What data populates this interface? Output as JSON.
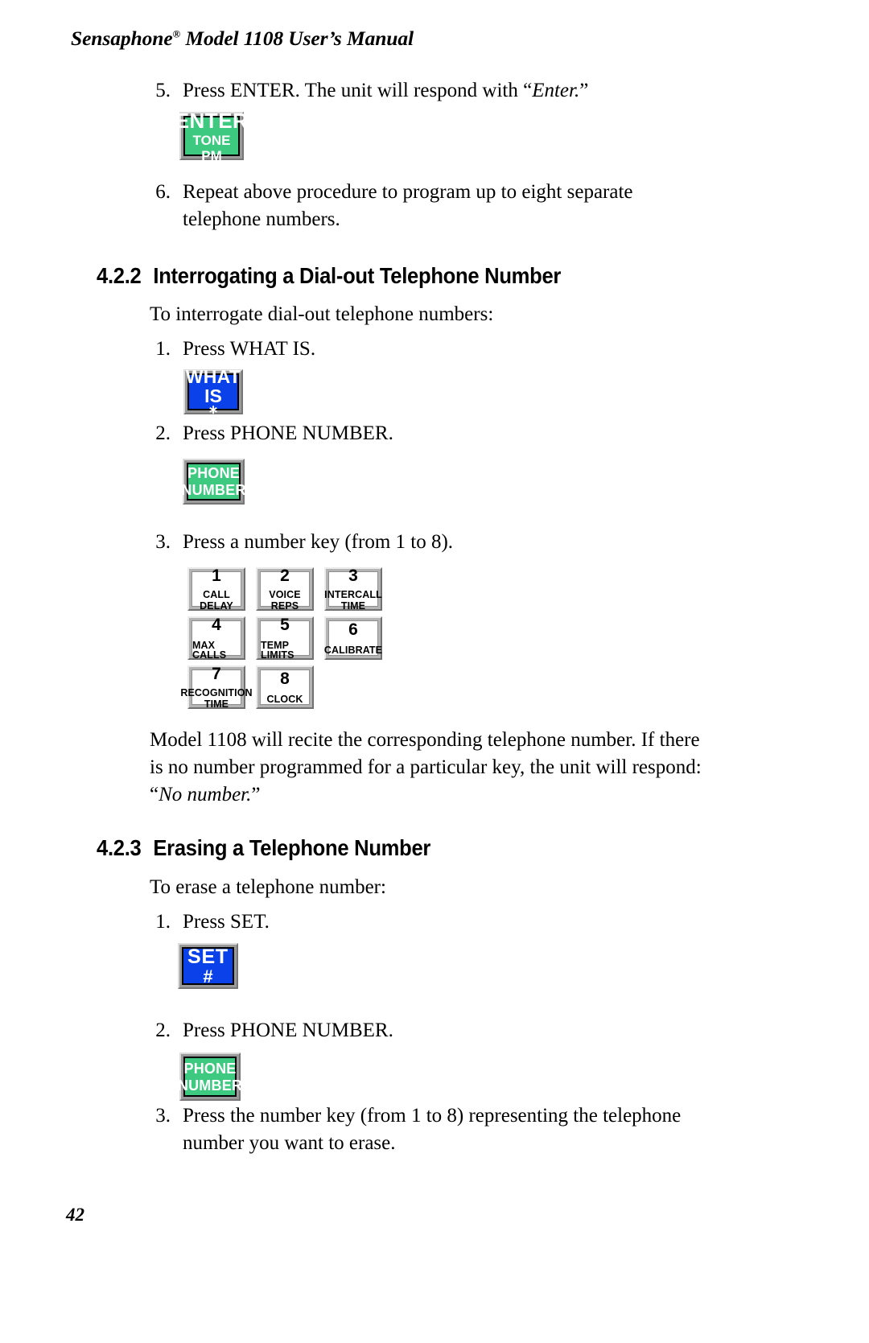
{
  "header": {
    "title_main": "Sensaphone",
    "registered_mark": "®",
    "title_rest": " Model 1108 User’s Manual"
  },
  "footer": {
    "page_number": "42"
  },
  "steps": {
    "s5": {
      "num": "5.",
      "text_before": "Press ENTER. The unit will respond with “",
      "text_italic": "Enter.",
      "text_after": "”"
    },
    "s6": {
      "num": "6.",
      "text": "Repeat above procedure to program up to eight separate telephone numbers."
    },
    "i1": {
      "num": "1.",
      "text": "Press WHAT IS."
    },
    "i2": {
      "num": "2.",
      "text": "Press PHONE NUMBER."
    },
    "i3": {
      "num": "3.",
      "text": "Press a number key (from 1 to 8)."
    },
    "e1": {
      "num": "1.",
      "text": "Press SET."
    },
    "e2": {
      "num": "2.",
      "text": "Press PHONE NUMBER."
    },
    "e3": {
      "num": "3.",
      "text": "Press the number key (from 1 to 8) representing the telephone number you want to erase."
    }
  },
  "sections": {
    "s422": {
      "number": "4.2.2",
      "title": "Interrogating a Dial-out Telephone Number"
    },
    "s423": {
      "number": "4.2.3",
      "title": "Erasing a Telephone Number"
    }
  },
  "paragraphs": {
    "intro_422": "To interrogate dial-out telephone numbers:",
    "recite_before": "Model 1108 will recite the corresponding telephone number. If there is no number programmed for a particular key, the unit will respond: “",
    "recite_italic": "No number.",
    "recite_after": "”",
    "intro_423": "To erase a telephone number:"
  },
  "keys": {
    "enter": {
      "line1": "ENTER",
      "line2": "TONE",
      "line3": "PM",
      "color": "#3ec981"
    },
    "whatis": {
      "line1": "WHAT",
      "line2": "IS",
      "line3": "∗",
      "color": "#0a41e8"
    },
    "phone1": {
      "line1": "PHONE",
      "line2": "NUMBER",
      "color": "#3ec981"
    },
    "phone2": {
      "line1": "PHONE",
      "line2": "NUMBER",
      "color": "#3ec981"
    },
    "set": {
      "line1": "SET",
      "line2": "#",
      "color": "#0a41e8"
    }
  },
  "keypad": [
    {
      "digit": "1",
      "label_line1": "CALL",
      "label_line2": "DELAY"
    },
    {
      "digit": "2",
      "label_line1": "VOICE",
      "label_line2": "REPS"
    },
    {
      "digit": "3",
      "label_line1": "INTERCALL",
      "label_line2": "TIME"
    },
    {
      "digit": "4",
      "label_line1": "MAX CALLS",
      "label_line2": ""
    },
    {
      "digit": "5",
      "label_line1": "TEMP LIMITS",
      "label_line2": ""
    },
    {
      "digit": "6",
      "label_line1": "CALIBRATE",
      "label_line2": ""
    },
    {
      "digit": "7",
      "label_line1": "RECOGNITION",
      "label_line2": "TIME"
    },
    {
      "digit": "8",
      "label_line1": "CLOCK",
      "label_line2": ""
    }
  ]
}
